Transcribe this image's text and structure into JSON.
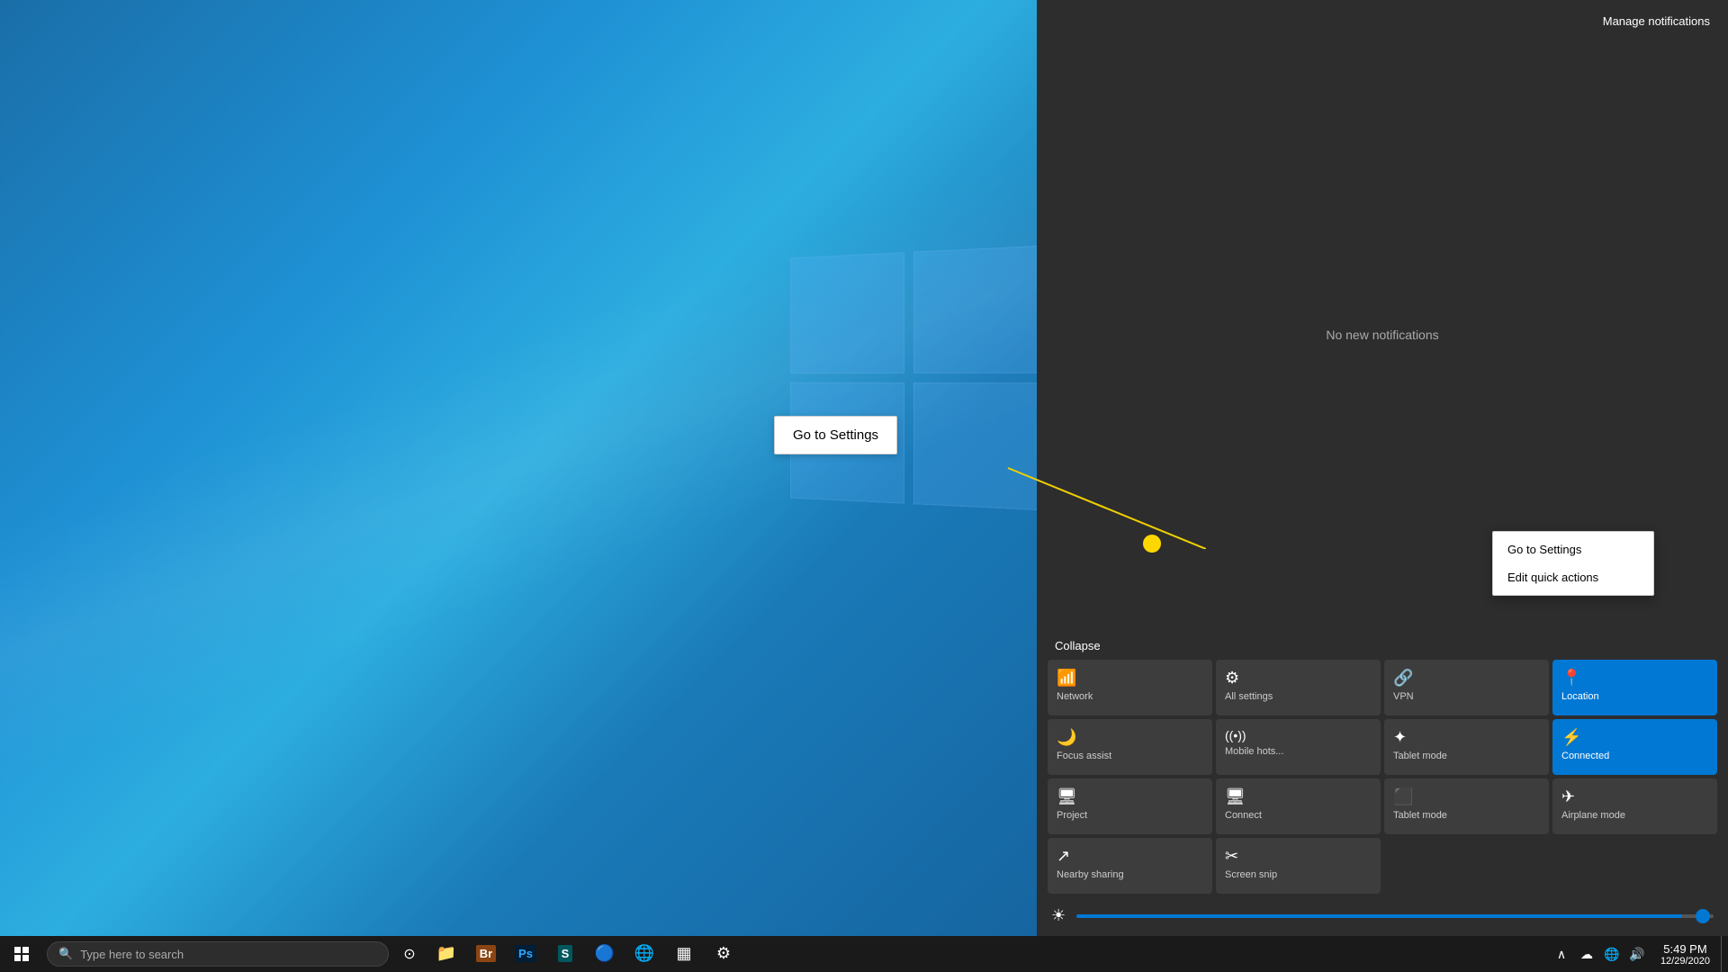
{
  "desktop": {
    "background": "blue gradient"
  },
  "action_center": {
    "manage_notifications": "Manage notifications",
    "no_notifications": "No new notifications",
    "collapse_label": "Collapse",
    "quick_tiles": [
      {
        "id": "network",
        "label": "Network",
        "icon": "📶",
        "active": false
      },
      {
        "id": "all-settings",
        "label": "All settings",
        "icon": "⚙",
        "active": false
      },
      {
        "id": "vpn",
        "label": "VPN",
        "icon": "🔗",
        "active": false
      },
      {
        "id": "location",
        "label": "Location",
        "icon": "📍",
        "active": true
      },
      {
        "id": "focus-assist",
        "label": "Focus assist",
        "icon": "🌙",
        "active": false
      },
      {
        "id": "mobile-hotspot",
        "label": "Mobile hots...",
        "icon": "((•))",
        "active": false
      },
      {
        "id": "tablet-mode",
        "label": "Tablet mode",
        "icon": "✦",
        "active": false
      },
      {
        "id": "bluetooth",
        "label": "Connected",
        "icon": "⚡",
        "active": true
      },
      {
        "id": "project",
        "label": "Project",
        "icon": "🖥",
        "active": false
      },
      {
        "id": "connect",
        "label": "Connect",
        "icon": "🖥",
        "active": false
      },
      {
        "id": "tablet-mode2",
        "label": "Tablet mode",
        "icon": "⬛",
        "active": false
      },
      {
        "id": "airplane-mode",
        "label": "Airplane mode",
        "icon": "✈",
        "active": false
      },
      {
        "id": "nearby-sharing",
        "label": "Nearby sharing",
        "icon": "↗",
        "active": false
      },
      {
        "id": "screen-snip",
        "label": "Screen snip",
        "icon": "✂",
        "active": false
      }
    ],
    "brightness_icon": "☀"
  },
  "context_menu": {
    "items": [
      {
        "id": "go-to-settings",
        "label": "Go to Settings"
      },
      {
        "id": "edit-quick-actions",
        "label": "Edit quick actions"
      }
    ]
  },
  "goto_popup": {
    "label": "Go to Settings"
  },
  "taskbar": {
    "search_placeholder": "Type here to search",
    "clock_time": "5:49 PM",
    "clock_date": "12/29/2020",
    "apps": [
      {
        "id": "file-explorer",
        "icon": "📁"
      },
      {
        "id": "bridge",
        "icon": "🅱"
      },
      {
        "id": "photoshop",
        "icon": "Ps"
      },
      {
        "id": "app5",
        "icon": "S"
      },
      {
        "id": "app6",
        "icon": "🔵"
      },
      {
        "id": "chrome",
        "icon": "🌐"
      },
      {
        "id": "app8",
        "icon": "▦"
      },
      {
        "id": "settings",
        "icon": "⚙"
      }
    ],
    "tray_icons": [
      "^",
      "☁",
      "📶",
      "🔊"
    ]
  }
}
